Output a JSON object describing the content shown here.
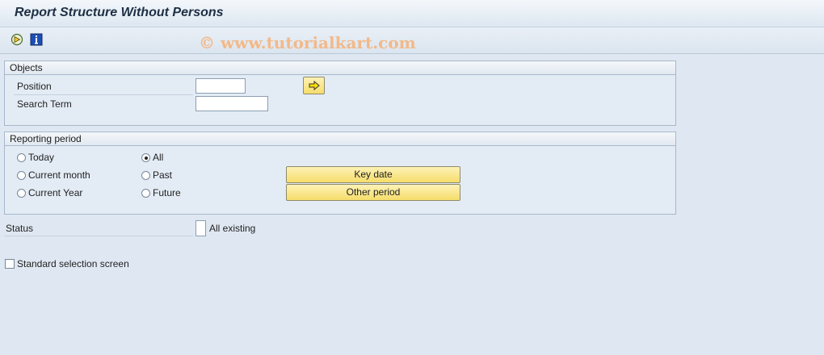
{
  "window": {
    "title": "Report Structure Without Persons"
  },
  "toolbar": {
    "execute_icon": "execute-icon",
    "info_icon": "info-icon"
  },
  "watermark": "© www.tutorialkart.com",
  "objects": {
    "header": "Objects",
    "position_label": "Position",
    "position_value": "",
    "search_term_label": "Search Term",
    "search_term_value": "",
    "multiple_selection_icon": "arrow-right-icon"
  },
  "reporting_period": {
    "header": "Reporting period",
    "options": [
      {
        "label": "Today",
        "selected": false
      },
      {
        "label": "Current month",
        "selected": false
      },
      {
        "label": "Current Year",
        "selected": false
      },
      {
        "label": "All",
        "selected": true
      },
      {
        "label": "Past",
        "selected": false
      },
      {
        "label": "Future",
        "selected": false
      }
    ],
    "key_date_button": "Key date",
    "other_period_button": "Other period"
  },
  "status": {
    "label": "Status",
    "all_existing_label": "All existing"
  },
  "standard_selection": {
    "label": "Standard selection screen",
    "checked": false
  },
  "colors": {
    "background": "#dfe8f2",
    "button_yellow": "#f6dd6a",
    "title": "#1e2f44"
  }
}
